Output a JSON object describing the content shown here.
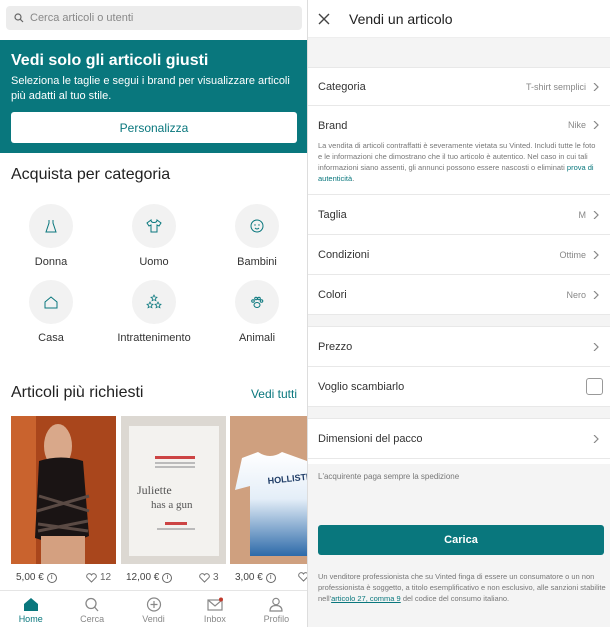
{
  "left": {
    "search_placeholder": "Cerca articoli o utenti",
    "banner": {
      "title": "Vedi solo gli articoli giusti",
      "subtitle": "Seleziona le taglie e segui i brand per visualizzare articoli più adatti al tuo stile.",
      "button": "Personalizza"
    },
    "categories_title": "Acquista per categoria",
    "categories": [
      {
        "label": "Donna",
        "icon": "dress-icon"
      },
      {
        "label": "Uomo",
        "icon": "shirt-icon"
      },
      {
        "label": "Bambini",
        "icon": "baby-face-icon"
      },
      {
        "label": "Casa",
        "icon": "house-icon"
      },
      {
        "label": "Intrattenimento",
        "icon": "stars-icon"
      },
      {
        "label": "Animali",
        "icon": "paw-icon"
      }
    ],
    "popular_title": "Articoli più richiesti",
    "see_all": "Vedi tutti",
    "products": [
      {
        "price": "5,00 €",
        "likes": "12"
      },
      {
        "price": "12,00 €",
        "likes": "3"
      },
      {
        "price": "3,00 €",
        "likes": ""
      }
    ],
    "book_text": {
      "line1": "Juliette",
      "line2": "has a gun"
    },
    "shirt_text": "HOLLISTER",
    "nav": [
      {
        "label": "Home",
        "icon": "home-icon"
      },
      {
        "label": "Cerca",
        "icon": "search-icon"
      },
      {
        "label": "Vendi",
        "icon": "plus-circle-icon"
      },
      {
        "label": "Inbox",
        "icon": "mail-icon"
      },
      {
        "label": "Profilo",
        "icon": "profile-icon"
      }
    ]
  },
  "right": {
    "title": "Vendi un articolo",
    "categoria": {
      "label": "Categoria",
      "value": "T-shirt semplici"
    },
    "brand": {
      "label": "Brand",
      "value": "Nike",
      "note": "La vendita di articoli contraffatti è severamente vietata su Vinted. Includi tutte le foto e le informazioni che dimostrano che il tuo articolo è autentico. Nel caso in cui tali informazioni siano assenti, gli annunci possono essere nascosti o eliminati",
      "note_link": "prova di autenticità"
    },
    "taglia": {
      "label": "Taglia",
      "value": "M"
    },
    "condizioni": {
      "label": "Condizioni",
      "value": "Ottime"
    },
    "colori": {
      "label": "Colori",
      "value": "Nero"
    },
    "prezzo": {
      "label": "Prezzo"
    },
    "scambio": {
      "label": "Voglio scambiarlo"
    },
    "pacco": {
      "label": "Dimensioni del pacco",
      "note": "L'acquirente paga sempre la spedizione"
    },
    "carica": "Carica",
    "legal": {
      "text": "Un venditore professionista che su Vinted finga di essere un consumatore o un non professionista è soggetto, a titolo esemplificativo e non esclusivo, alle sanzioni stabilite nell'",
      "link": "articolo 27, comma 9",
      "tail": " del codice del consumo italiano."
    }
  },
  "colors": {
    "accent": "#09777d"
  }
}
